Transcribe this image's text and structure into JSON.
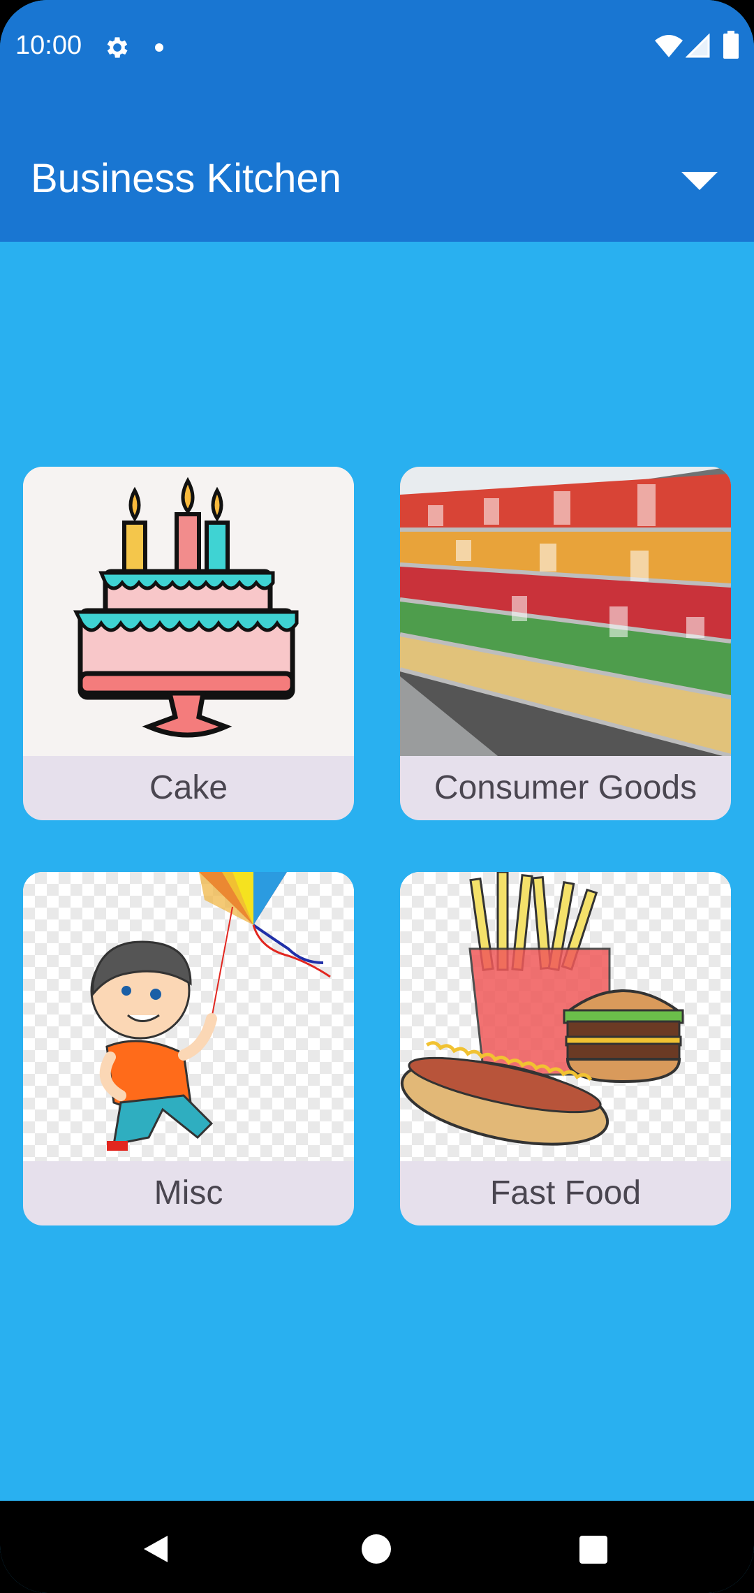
{
  "status_bar": {
    "time": "10:00",
    "icons": [
      "gear-icon",
      "notification-dot-icon",
      "wifi-icon",
      "signal-icon",
      "battery-icon"
    ]
  },
  "app_bar": {
    "title": "Business Kitchen",
    "dropdown_icon": "triangle-down-icon"
  },
  "categories": [
    {
      "label": "Cake",
      "image": "birthday-cake-illustration"
    },
    {
      "label": "Consumer Goods",
      "image": "supermarket-aisle-photo"
    },
    {
      "label": "Misc",
      "image": "boy-with-kite-illustration"
    },
    {
      "label": "Fast Food",
      "image": "fries-burger-hotdog-illustration"
    }
  ],
  "nav_bar": {
    "icons": [
      "back-icon",
      "home-icon",
      "recents-icon"
    ]
  },
  "colors": {
    "app_bar": "#1976D2",
    "background": "#29B0F0",
    "card_label_bg": "#E6E0EC",
    "card_text": "#4A4650"
  }
}
